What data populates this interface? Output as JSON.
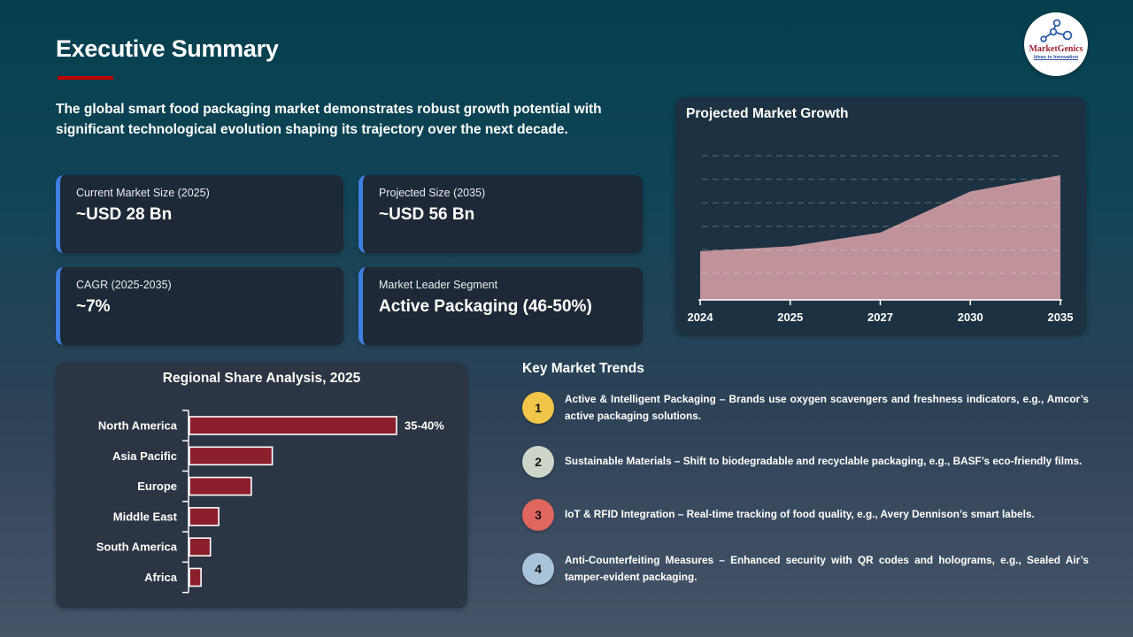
{
  "page": {
    "title": "Executive Summary",
    "intro": "The global smart food packaging market demonstrates robust growth potential with significant technological evolution shaping its trajectory over the next decade."
  },
  "logo": {
    "name": "MarketGenics",
    "tagline": "Ideas to Innovation",
    "name_color": "#9e2235",
    "tagline_color": "#2b4da0",
    "icon": "molecule-icon"
  },
  "stat_cards": [
    {
      "label": "Current Market Size (2025)",
      "value": "~USD 28 Bn"
    },
    {
      "label": "Projected Size (2035)",
      "value": "~USD 56 Bn"
    },
    {
      "label": "CAGR (2025-2035)",
      "value": "~7%"
    },
    {
      "label": "Market Leader Segment",
      "value": "Active Packaging (46-50%)"
    }
  ],
  "chart_data": [
    {
      "type": "area",
      "title": "Projected Market Growth",
      "x": [
        "2024",
        "2025",
        "2027",
        "2030",
        "2035"
      ],
      "values": [
        39,
        43,
        54,
        87,
        100
      ],
      "units": "relative height %; no y-axis tick labels shown",
      "ylim": [
        0,
        115
      ],
      "grid": "horizontal dashed, 6 unlabeled gridlines",
      "legend": "none",
      "fill_color": "#c0939a",
      "axis_color": "#ffffff"
    },
    {
      "type": "bar",
      "title": "Regional Share Analysis, 2025",
      "orientation": "horizontal",
      "categories": [
        "North America",
        "Asia Pacific",
        "Europe",
        "Middle East",
        "South America",
        "Africa"
      ],
      "values": [
        37.5,
        15,
        11.2,
        5.3,
        3.8,
        2.1
      ],
      "data_labels": [
        "35-40%",
        "",
        "",
        "",
        "",
        ""
      ],
      "units": "percent share; values estimated from bar lengths, only North America labeled",
      "bar_color": "#8b1f2b",
      "bar_border_color": "#ffffff",
      "axis_color": "#ffffff",
      "grid": "off",
      "legend": "none"
    }
  ],
  "trends": {
    "heading": "Key Market Trends",
    "items": [
      {
        "num": "1",
        "color": "#f0c54a",
        "text": "Active & Intelligent Packaging – Brands use oxygen scavengers and freshness indicators, e.g., Amcor’s active packaging solutions."
      },
      {
        "num": "2",
        "color": "#cdd5c8",
        "text": "Sustainable Materials – Shift to biodegradable and recyclable packaging, e.g., BASF’s eco-friendly films."
      },
      {
        "num": "3",
        "color": "#df6760",
        "text": "IoT & RFID Integration – Real-time tracking of food quality, e.g., Avery Dennison’s smart labels."
      },
      {
        "num": "4",
        "color": "#a9c3d8",
        "text": "Anti-Counterfeiting Measures – Enhanced security with QR codes and holograms, e.g., Sealed Air’s tamper-evident packaging."
      }
    ]
  },
  "colors": {
    "background_top": "#05404f",
    "background_bottom": "#475469",
    "title_rule": "#c00000",
    "card_background": "#1d2936",
    "card_accent": "#3f7ee0",
    "growth_panel_background": "#1c3242",
    "regional_panel_background": "#2b3544",
    "text": "#ffffff"
  }
}
